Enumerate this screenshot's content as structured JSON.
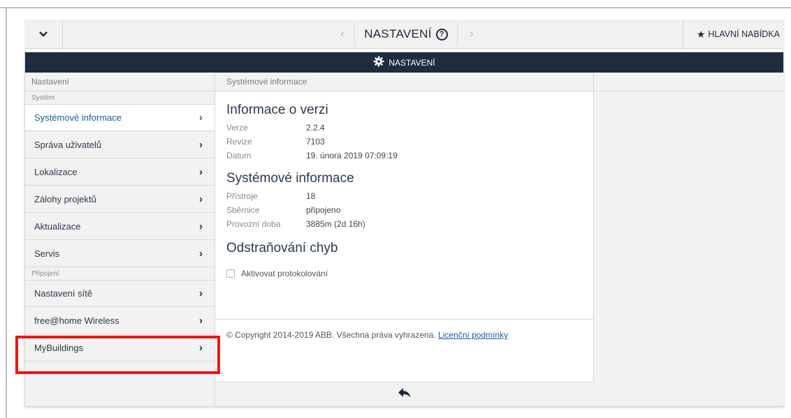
{
  "topbar": {
    "title": "NASTAVENÍ",
    "main_menu_label": "HLAVNÍ NABÍDKA"
  },
  "panel": {
    "header_title": "NASTAVENÍ"
  },
  "left": {
    "column_header": "Nastavení",
    "section_system": "Systém",
    "items_system": [
      {
        "label": "Systémové informace"
      },
      {
        "label": "Správa uživatelů"
      },
      {
        "label": "Lokalizace"
      },
      {
        "label": "Zálohy projektů"
      },
      {
        "label": "Aktualizace"
      },
      {
        "label": "Servis"
      }
    ],
    "section_connection": "Připojení",
    "items_connection": [
      {
        "label": "Nastavení sítě"
      },
      {
        "label": "free@home Wireless"
      },
      {
        "label": "MyBuildings"
      }
    ]
  },
  "middle": {
    "column_header": "Systémové informace",
    "version": {
      "heading": "Informace o verzi",
      "rows": [
        {
          "key": "Verze",
          "value": "2.2.4"
        },
        {
          "key": "Revize",
          "value": "7103"
        },
        {
          "key": "Datum",
          "value": "19. února 2019 07:09:19"
        }
      ]
    },
    "system": {
      "heading": "Systémové informace",
      "rows": [
        {
          "key": "Přístroje",
          "value": "18"
        },
        {
          "key": "Sběrnice",
          "value": "připojeno"
        },
        {
          "key": "Provozní doba",
          "value": "3885m (2d 16h)"
        }
      ]
    },
    "debug": {
      "heading": "Odstraňování chyb",
      "checkbox_label": "Aktivovat protokolování",
      "checked": false
    },
    "copyright": "© Copyright 2014-2019 ABB. Všechna práva vyhrazena.",
    "license_link": "Licenční podmínky"
  },
  "colors": {
    "header_bg": "#1e2c3e",
    "active_text": "#1f5aa6",
    "highlight": "#ea1717"
  }
}
